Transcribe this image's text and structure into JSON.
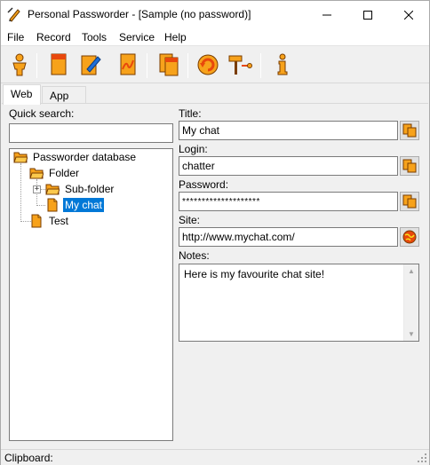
{
  "window": {
    "title": "Personal Passworder - [Sample (no password)]"
  },
  "menu": {
    "items": [
      "File",
      "Record",
      "Tools",
      "Service",
      "Help"
    ]
  },
  "toolbar": {
    "buttons": [
      "user-icon",
      "new-record-icon",
      "edit-record-icon",
      "rename-icon",
      "copy-record-icon",
      "refresh-icon",
      "tools-icon",
      "info-icon"
    ]
  },
  "tabs": [
    {
      "label": "Web",
      "active": true
    },
    {
      "label": "App",
      "active": false
    }
  ],
  "search": {
    "label": "Quick search:",
    "value": "",
    "underline_char": "Q"
  },
  "tree": {
    "root": "Passworder database",
    "folder": "Folder",
    "subfolder": "Sub-folder",
    "selected_item": "My chat",
    "item": "Test"
  },
  "form": {
    "title_label": "Title:",
    "title_value": "My chat",
    "login_label": "Login:",
    "login_value": "chatter",
    "password_label": "Password:",
    "password_value": "********************",
    "site_label": "Site:",
    "site_value": "http://www.mychat.com/",
    "notes_label": "Notes:",
    "notes_value": "Here is my favourite chat site!"
  },
  "status": {
    "clipboard_label": "Clipboard:"
  },
  "colors": {
    "selection": "#0078d7",
    "icon_orange": "#f7a21b",
    "icon_red": "#e8480c"
  }
}
